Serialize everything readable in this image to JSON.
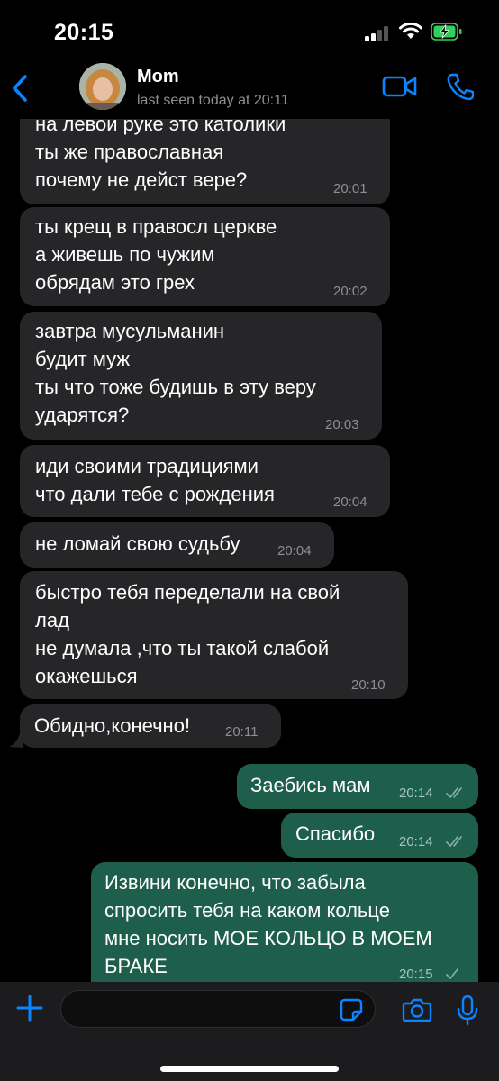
{
  "status_bar": {
    "time": "20:15"
  },
  "header": {
    "contact_name": "Mom",
    "contact_status": "last seen today at 20:11"
  },
  "messages": [
    {
      "direction": "incoming",
      "text": "на левой руке это католики\nты же православная\nпочему не дейст вере?",
      "time": "20:01"
    },
    {
      "direction": "incoming",
      "text": "ты крещ в правосл церкве\nа живешь по чужим\nобрядам это грех",
      "time": "20:02"
    },
    {
      "direction": "incoming",
      "text": "завтра мусульманин\nбудит муж\nты что тоже будишь в эту веру\nударятся?",
      "time": "20:03"
    },
    {
      "direction": "incoming",
      "text": "иди своими традициями\nчто дали тебе с рождения",
      "time": "20:04"
    },
    {
      "direction": "incoming",
      "text": "не ломай свою судьбу",
      "time": "20:04"
    },
    {
      "direction": "incoming",
      "text": "быстро тебя переделали на свой\nлад\nне думала ,что ты такой слабой\nокажешься",
      "time": "20:10"
    },
    {
      "direction": "incoming",
      "text": "Обидно,конечно!",
      "time": "20:11"
    },
    {
      "direction": "outgoing",
      "text": "Заебись мам",
      "time": "20:14",
      "status": "read"
    },
    {
      "direction": "outgoing",
      "text": "Спасибо",
      "time": "20:14",
      "status": "read"
    },
    {
      "direction": "outgoing",
      "text": "Извини конечно, что забыла\nспросить тебя на каком кольце\nмне носить МОЕ КОЛЬЦО В МОЕМ\nБРАКЕ",
      "time": "20:15",
      "status": "delivered"
    }
  ],
  "composer": {
    "value": "",
    "placeholder": ""
  },
  "colors": {
    "accent": "#0a84ff",
    "incoming_bubble": "#262628",
    "outgoing_bubble": "#1e5f4c",
    "battery_charging": "#30d158"
  },
  "icons": {
    "back": "chevron-left-icon",
    "video": "video-camera-icon",
    "call": "phone-icon",
    "attach": "plus-icon",
    "sticker": "sticker-icon",
    "camera": "camera-icon",
    "mic": "microphone-icon"
  }
}
